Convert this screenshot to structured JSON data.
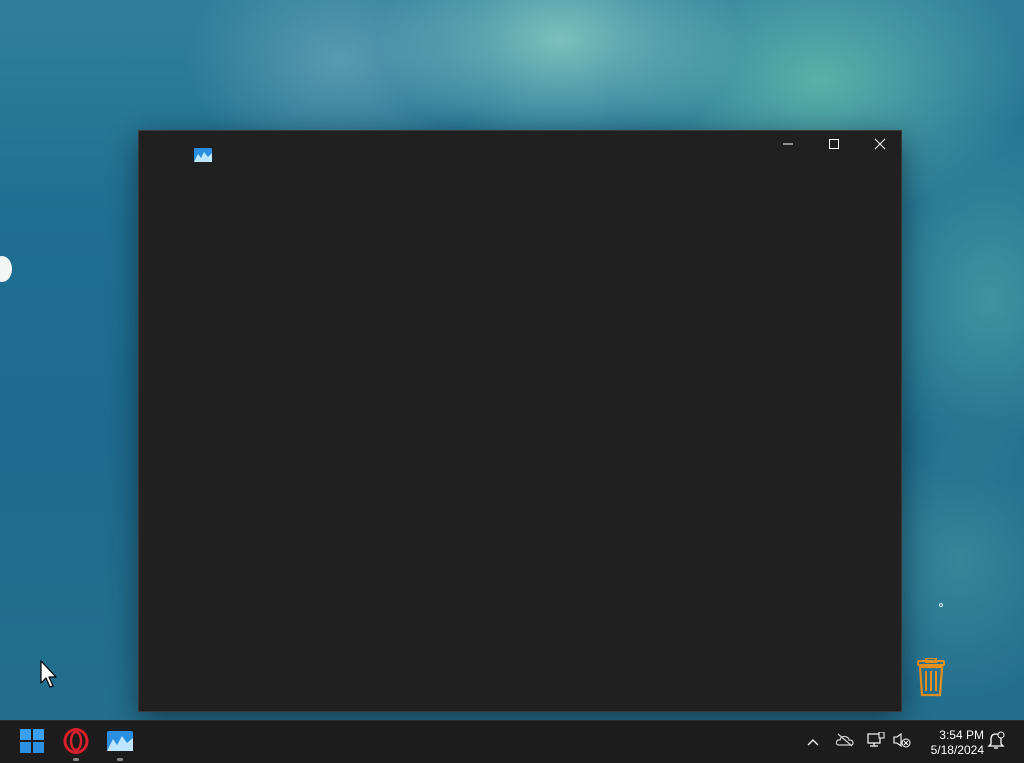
{
  "desktop": {
    "recycle_bin_icon": "recycle-bin-icon"
  },
  "window": {
    "title": "",
    "app_icon": "image-viewer-icon",
    "controls": {
      "minimize_icon": "minimize-icon",
      "maximize_icon": "maximize-icon",
      "close_icon": "close-icon"
    },
    "background_color": "#202020"
  },
  "taskbar": {
    "pinned": [
      {
        "icon": "windows-start-icon",
        "running": false
      },
      {
        "icon": "opera-browser-icon",
        "running": true
      },
      {
        "icon": "image-viewer-icon",
        "running": true
      }
    ],
    "tray": {
      "icons": [
        "chevron-up-icon",
        "onedrive-offline-icon",
        "network-icon",
        "volume-muted-icon",
        "notification-icon"
      ]
    },
    "clock": {
      "time": "3:54 PM",
      "date": "5/18/2024"
    }
  },
  "colors": {
    "taskbar": "#1c1c1c",
    "window": "#202020",
    "accent": "#0a84d8",
    "opera_red": "#d91f2b",
    "recycle_orange": "#e8901a"
  }
}
